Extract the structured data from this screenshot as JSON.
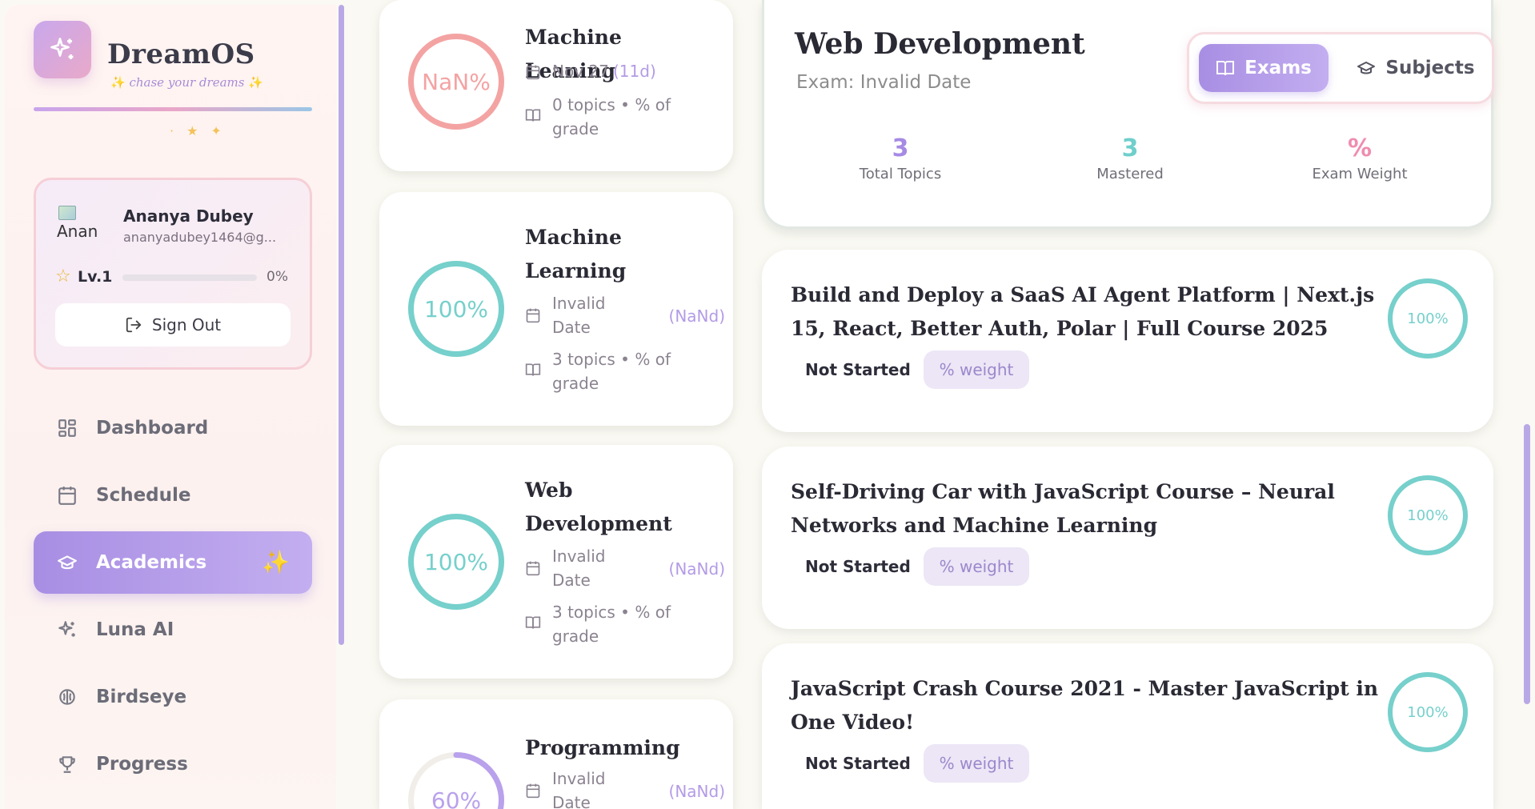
{
  "sidebar": {
    "brand": {
      "title": "DreamOS",
      "tagline": "chase your dreams"
    },
    "profile": {
      "avatar_alt": "Anan",
      "name": "Ananya Dubey",
      "email": "ananyadubey1464@g...",
      "level_label": "Lv.1",
      "level_progress": 0,
      "level_pct_text": "0%",
      "signout_label": "Sign Out"
    },
    "nav": [
      {
        "label": "Dashboard",
        "icon": "grid-icon"
      },
      {
        "label": "Schedule",
        "icon": "calendar-icon"
      },
      {
        "label": "Academics",
        "icon": "graduation-cap-icon",
        "active": true
      },
      {
        "label": "Luna AI",
        "icon": "sparkles-icon"
      },
      {
        "label": "Birdseye",
        "icon": "brain-icon"
      },
      {
        "label": "Progress",
        "icon": "trophy-icon"
      }
    ]
  },
  "exams": [
    {
      "ring_text": "NaN%",
      "progress": 1.0,
      "ring_color": "#f4a3a3",
      "title": "Machine Leaning",
      "date": "Nov 27",
      "days": "(11d)",
      "topics": "0 topics • % of grade"
    },
    {
      "ring_text": "100%",
      "progress": 1.0,
      "ring_color": "#76d0cc",
      "title": "Machine Learning",
      "date": "Invalid Date",
      "days": "(NaNd)",
      "topics": "3 topics • % of grade"
    },
    {
      "ring_text": "100%",
      "progress": 1.0,
      "ring_color": "#76d0cc",
      "title": "Web Development",
      "date": "Invalid Date",
      "days": "(NaNd)",
      "topics": "3 topics • % of grade"
    },
    {
      "ring_text": "60%",
      "progress": 0.6,
      "ring_color": "#b9a1ec",
      "title": "Programming",
      "date": "Invalid Date",
      "days": "(NaNd)",
      "topics": ""
    }
  ],
  "detail": {
    "title": "Web Development",
    "subtitle": "Exam: Invalid Date",
    "toggle": {
      "exams_label": "Exams",
      "subjects_label": "Subjects"
    },
    "stats": [
      {
        "value": "3",
        "label": "Total Topics",
        "color": "#a68ae4"
      },
      {
        "value": "3",
        "label": "Mastered",
        "color": "#6fcfcb"
      },
      {
        "value": "%",
        "label": "Exam Weight",
        "color": "#f08cb0"
      }
    ]
  },
  "topics": [
    {
      "title": "Build and Deploy a SaaS AI Agent Platform | Next.js 15, React, Better Auth, Polar | Full Course 2025",
      "status": "Not Started",
      "weight": "% weight",
      "ring_text": "100%",
      "progress": 1.0
    },
    {
      "title": "Self-Driving Car with JavaScript Course – Neural Networks and Machine Learning",
      "status": "Not Started",
      "weight": "% weight",
      "ring_text": "100%",
      "progress": 1.0
    },
    {
      "title": "JavaScript Crash Course 2021 - Master JavaScript in One Video!",
      "status": "Not Started",
      "weight": "% weight",
      "ring_text": "100%",
      "progress": 1.0
    }
  ],
  "colors": {
    "accent": "#a88ee3",
    "teal": "#76d0cc",
    "coral": "#f4a3a3",
    "gold": "#f3b642"
  }
}
